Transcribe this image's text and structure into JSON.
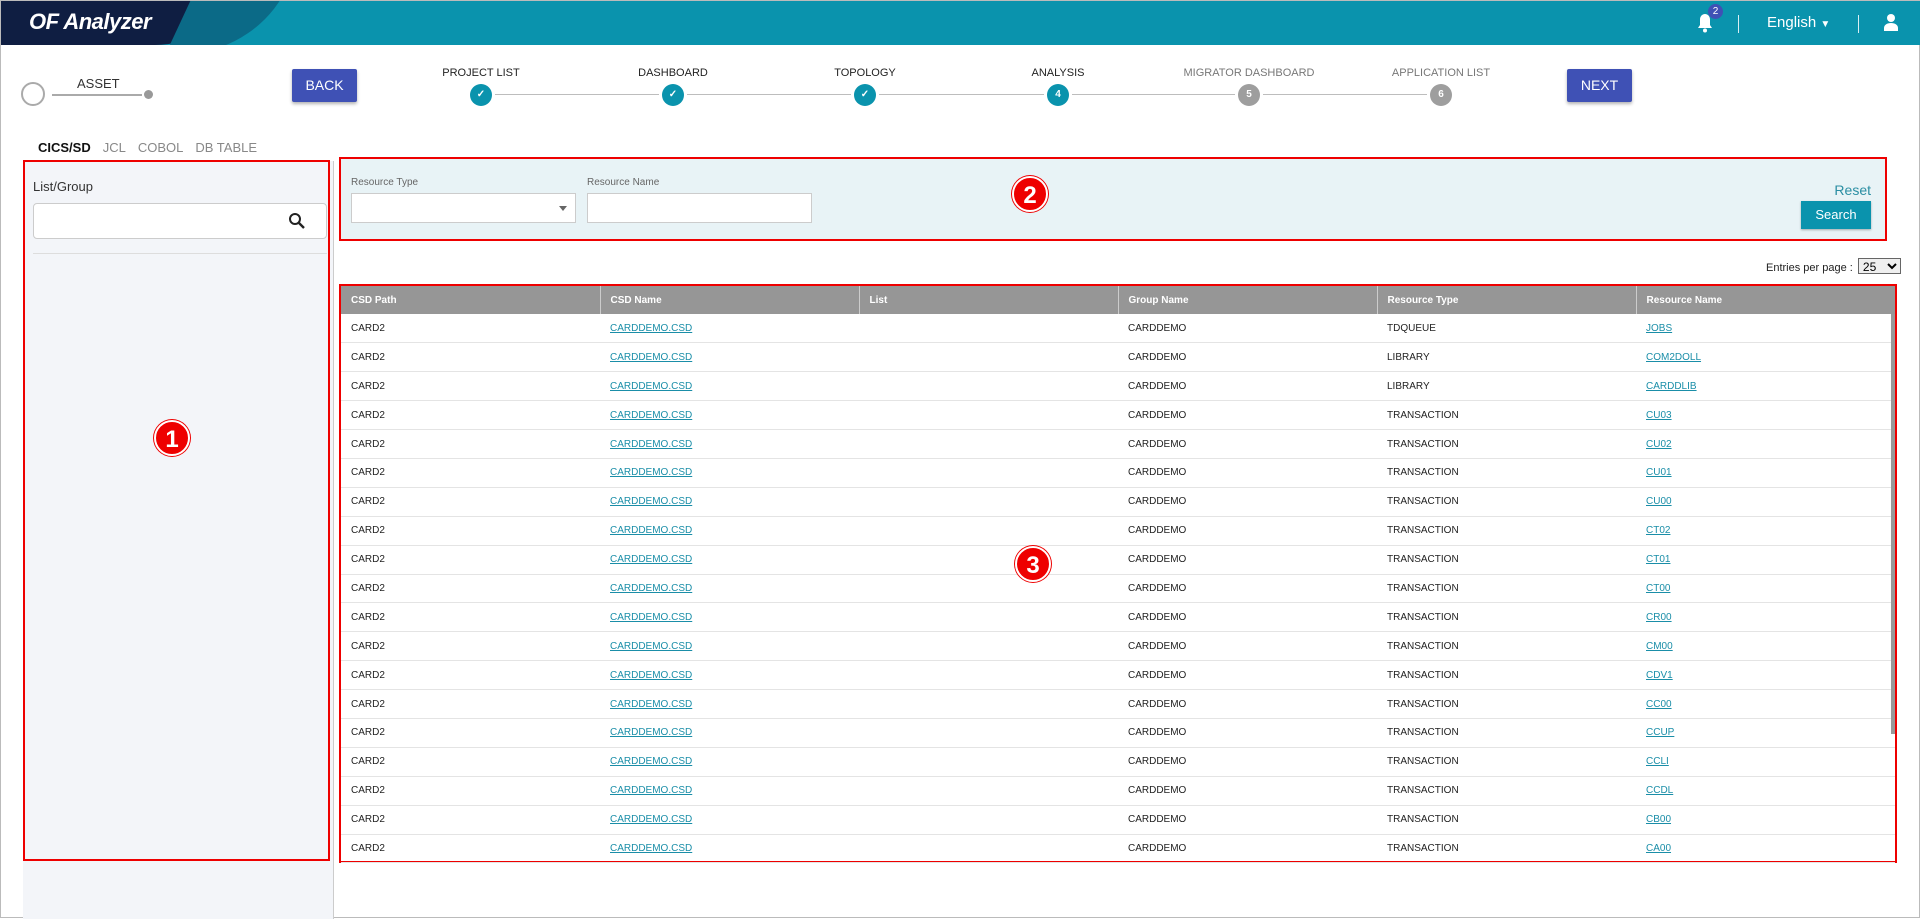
{
  "header": {
    "app_title": "OF Analyzer",
    "notification_count": "2",
    "language": "English",
    "brand_color": "#0a93ad"
  },
  "asset": {
    "label": "ASSET"
  },
  "nav": {
    "back_label": "BACK",
    "next_label": "NEXT"
  },
  "steps": [
    {
      "label": "PROJECT LIST",
      "mark": "✓",
      "state": "done"
    },
    {
      "label": "DASHBOARD",
      "mark": "✓",
      "state": "done"
    },
    {
      "label": "TOPOLOGY",
      "mark": "✓",
      "state": "done"
    },
    {
      "label": "ANALYSIS",
      "mark": "4",
      "state": "current"
    },
    {
      "label": "MIGRATOR DASHBOARD",
      "mark": "5",
      "state": "pending"
    },
    {
      "label": "APPLICATION LIST",
      "mark": "6",
      "state": "pending"
    }
  ],
  "tabs": [
    {
      "label": "CICS/SD",
      "active": true
    },
    {
      "label": "JCL"
    },
    {
      "label": "COBOL"
    },
    {
      "label": "DB TABLE"
    }
  ],
  "left_panel": {
    "title": "List/Group",
    "search_value": ""
  },
  "filter": {
    "resource_type_label": "Resource Type",
    "resource_type_value": "",
    "resource_name_label": "Resource Name",
    "resource_name_value": "",
    "reset_label": "Reset",
    "search_label": "Search"
  },
  "entries": {
    "label": "Entries per page :",
    "value": "25"
  },
  "annotations": [
    "1",
    "2",
    "3"
  ],
  "table": {
    "columns": [
      "CSD Path",
      "CSD Name",
      "List",
      "Group Name",
      "Resource Type",
      "Resource Name"
    ],
    "rows": [
      [
        "CARD2",
        "CARDDEMO.CSD",
        "",
        "CARDDEMO",
        "TDQUEUE",
        "JOBS"
      ],
      [
        "CARD2",
        "CARDDEMO.CSD",
        "",
        "CARDDEMO",
        "LIBRARY",
        "COM2DOLL"
      ],
      [
        "CARD2",
        "CARDDEMO.CSD",
        "",
        "CARDDEMO",
        "LIBRARY",
        "CARDDLIB"
      ],
      [
        "CARD2",
        "CARDDEMO.CSD",
        "",
        "CARDDEMO",
        "TRANSACTION",
        "CU03"
      ],
      [
        "CARD2",
        "CARDDEMO.CSD",
        "",
        "CARDDEMO",
        "TRANSACTION",
        "CU02"
      ],
      [
        "CARD2",
        "CARDDEMO.CSD",
        "",
        "CARDDEMO",
        "TRANSACTION",
        "CU01"
      ],
      [
        "CARD2",
        "CARDDEMO.CSD",
        "",
        "CARDDEMO",
        "TRANSACTION",
        "CU00"
      ],
      [
        "CARD2",
        "CARDDEMO.CSD",
        "",
        "CARDDEMO",
        "TRANSACTION",
        "CT02"
      ],
      [
        "CARD2",
        "CARDDEMO.CSD",
        "",
        "CARDDEMO",
        "TRANSACTION",
        "CT01"
      ],
      [
        "CARD2",
        "CARDDEMO.CSD",
        "",
        "CARDDEMO",
        "TRANSACTION",
        "CT00"
      ],
      [
        "CARD2",
        "CARDDEMO.CSD",
        "",
        "CARDDEMO",
        "TRANSACTION",
        "CR00"
      ],
      [
        "CARD2",
        "CARDDEMO.CSD",
        "",
        "CARDDEMO",
        "TRANSACTION",
        "CM00"
      ],
      [
        "CARD2",
        "CARDDEMO.CSD",
        "",
        "CARDDEMO",
        "TRANSACTION",
        "CDV1"
      ],
      [
        "CARD2",
        "CARDDEMO.CSD",
        "",
        "CARDDEMO",
        "TRANSACTION",
        "CC00"
      ],
      [
        "CARD2",
        "CARDDEMO.CSD",
        "",
        "CARDDEMO",
        "TRANSACTION",
        "CCUP"
      ],
      [
        "CARD2",
        "CARDDEMO.CSD",
        "",
        "CARDDEMO",
        "TRANSACTION",
        "CCLI"
      ],
      [
        "CARD2",
        "CARDDEMO.CSD",
        "",
        "CARDDEMO",
        "TRANSACTION",
        "CCDL"
      ],
      [
        "CARD2",
        "CARDDEMO.CSD",
        "",
        "CARDDEMO",
        "TRANSACTION",
        "CB00"
      ],
      [
        "CARD2",
        "CARDDEMO.CSD",
        "",
        "CARDDEMO",
        "TRANSACTION",
        "CA00"
      ]
    ]
  }
}
